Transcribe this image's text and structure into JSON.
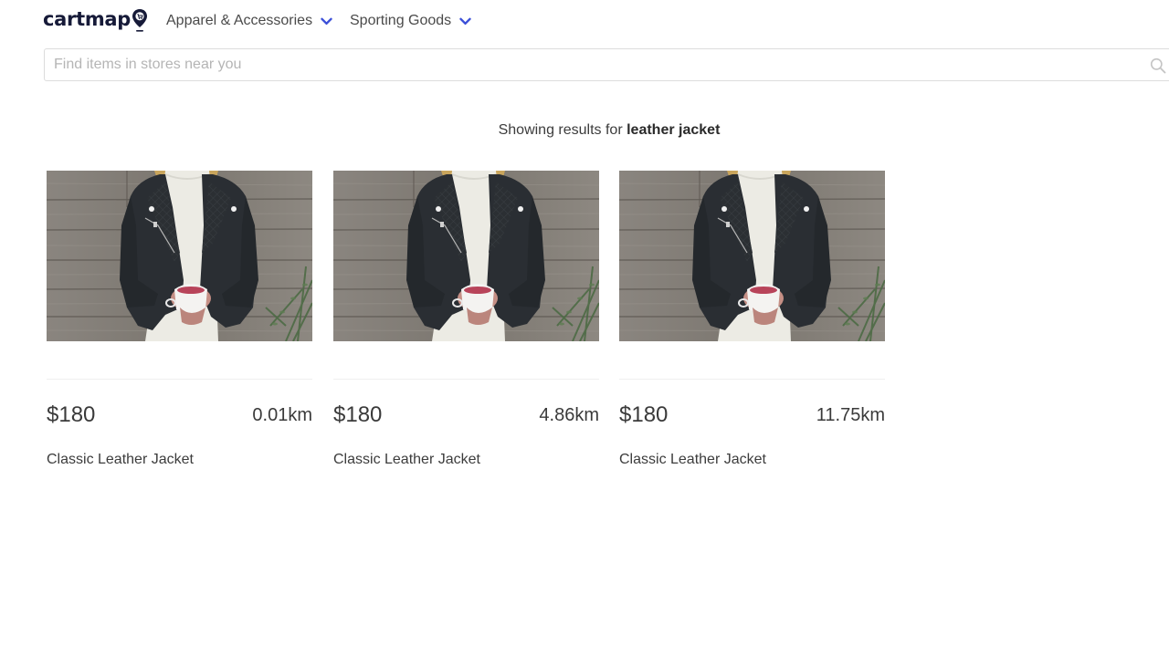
{
  "brand": {
    "name": "cartmap",
    "logo_icon": "map-pin-cart-icon",
    "color": "#161a38"
  },
  "nav": {
    "menus": [
      {
        "label": "Apparel & Accessories",
        "icon": "chevron-down-icon"
      },
      {
        "label": "Sporting Goods",
        "icon": "chevron-down-icon"
      }
    ],
    "chevron_color": "#3b4fd8"
  },
  "search": {
    "value": "",
    "placeholder": "Find items in stores near you",
    "icon": "search-icon"
  },
  "results": {
    "prefix": "Showing results for",
    "query": "leather jacket"
  },
  "products": [
    {
      "name": "Classic Leather Jacket",
      "price": "$180",
      "distance": "0.01km",
      "image_alt": "Person wearing a black leather jacket holding a cup of tea"
    },
    {
      "name": "Classic Leather Jacket",
      "price": "$180",
      "distance": "4.86km",
      "image_alt": "Person wearing a black leather jacket holding a cup of tea"
    },
    {
      "name": "Classic Leather Jacket",
      "price": "$180",
      "distance": "11.75km",
      "image_alt": "Person wearing a black leather jacket holding a cup of tea"
    }
  ]
}
